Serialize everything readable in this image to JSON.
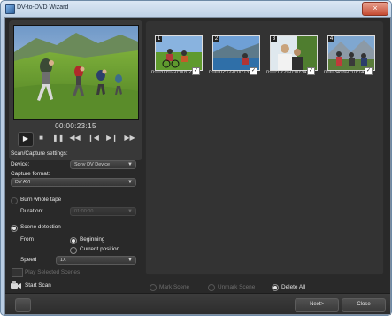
{
  "window": {
    "title": "DV-to-DVD Wizard"
  },
  "preview": {
    "timecode": "00:00:23:15"
  },
  "controls": [
    "play",
    "stop",
    "pause",
    "rewind",
    "previous-frame",
    "next-frame",
    "fast-forward"
  ],
  "thumbnails": [
    {
      "number": "1",
      "label": "0:00:00:02-0:00:02..."
    },
    {
      "number": "2",
      "label": "0:00:02:12-0:00:13..."
    },
    {
      "number": "3",
      "label": "0:00:13:29-0:00:34..."
    },
    {
      "number": "4",
      "label": "0:00:34:09-0:01:14..."
    }
  ],
  "settings": {
    "heading": "Scan/Capture settings:",
    "device_label": "Device:",
    "device_value": "Sony DV Device",
    "capture_format_label": "Capture format:",
    "capture_format_value": "DV AVI",
    "burn_whole_tape": "Burn whole tape",
    "duration_label": "Duration:",
    "duration_value": "01:00:00",
    "scene_detection": "Scene detection",
    "from_label": "From",
    "beginning": "Beginning",
    "current_position": "Current position",
    "speed_label": "Speed",
    "speed_value": "1X",
    "play_selected_scenes": "Play Selected Scenes",
    "start_scan": "Start Scan"
  },
  "scene_actions": {
    "mark_scene": "Mark Scene",
    "unmark_scene": "Unmark Scene",
    "delete_all": "Delete All"
  },
  "footer": {
    "next": "Next>",
    "close": "Close"
  }
}
